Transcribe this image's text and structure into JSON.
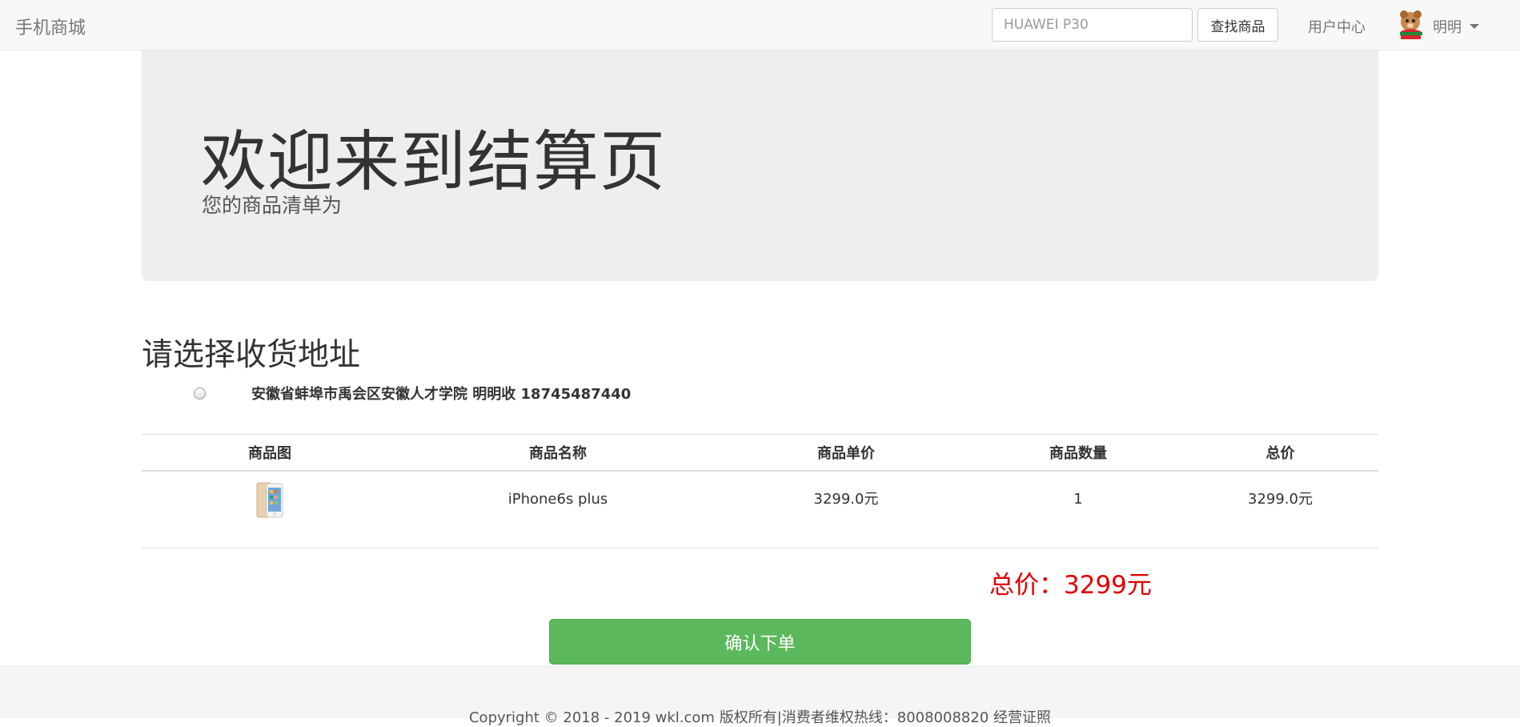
{
  "navbar": {
    "brand": "手机商城",
    "search_placeholder": "HUAWEI P30",
    "search_button": "查找商品",
    "user_center": "用户中心",
    "username": "明明"
  },
  "jumbotron": {
    "title": "欢迎来到结算页",
    "subtitle": "您的商品清单为"
  },
  "address": {
    "heading": "请选择收货地址",
    "options": [
      {
        "text": "安徽省蚌埠市禹会区安徽人才学院 明明收 18745487440",
        "selected": false
      }
    ]
  },
  "table": {
    "headers": [
      "商品图",
      "商品名称",
      "商品单价",
      "商品数量",
      "总价"
    ],
    "rows": [
      {
        "name": "iPhone6s plus",
        "unit_price": "3299.0元",
        "quantity": "1",
        "subtotal": "3299.0元"
      }
    ]
  },
  "total": "总价：3299元",
  "confirm_button": "确认下单",
  "footer": {
    "copyright": "Copyright © 2018 - 2019 wkl.com 版权所有|消费者维权热线：8008008820 经营证照"
  },
  "colors": {
    "total": "#e00000",
    "confirm": "#5cb85c"
  }
}
